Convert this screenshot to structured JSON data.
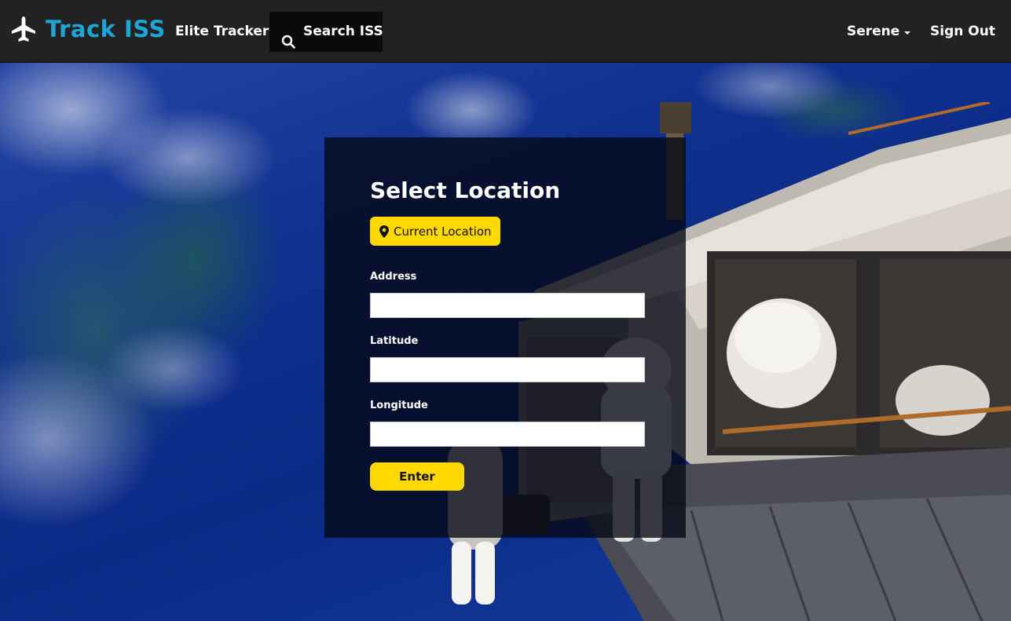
{
  "navbar": {
    "brand": "Track ISS",
    "brand_icon": "airplane-icon",
    "links": {
      "elite_tracker": "Elite Tracker",
      "search_iss": "Search ISS",
      "user": "Serene",
      "sign_out": "Sign Out"
    },
    "search_icon": "search-icon",
    "brand_color": "#1ea5d6",
    "bar_color": "#222222",
    "active_tab_color": "#0a0a0a"
  },
  "panel": {
    "title": "Select Location",
    "current_location_label": "Current Location",
    "current_location_icon": "map-marker-icon",
    "fields": {
      "address": {
        "label": "Address",
        "value": ""
      },
      "latitude": {
        "label": "Latitude",
        "value": ""
      },
      "longitude": {
        "label": "Longitude",
        "value": ""
      }
    },
    "submit_label": "Enter",
    "accent_color": "#ffd800"
  },
  "background": {
    "description_icon": "earth-and-iss-photo"
  }
}
